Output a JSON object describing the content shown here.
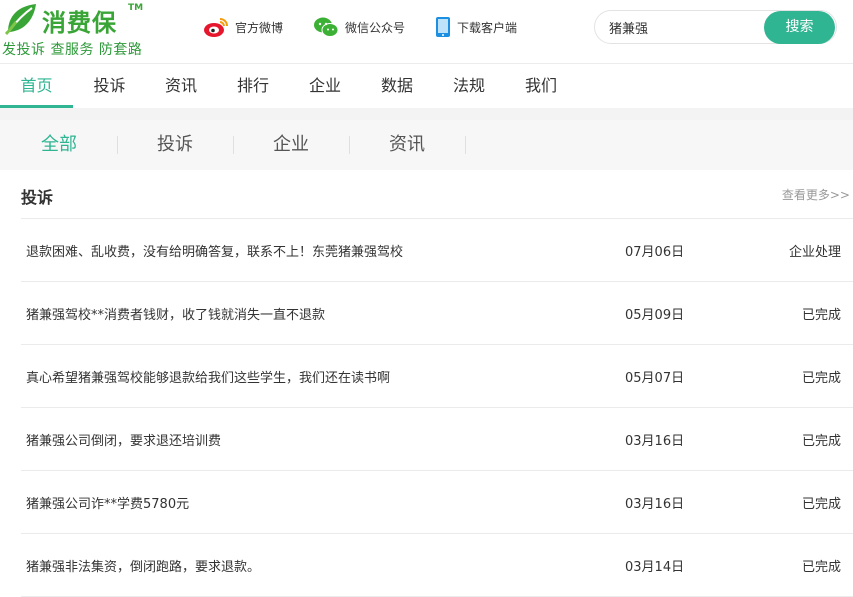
{
  "logo": {
    "name": "消费保",
    "tm": "TM",
    "slogan": "发投诉 查服务 防套路"
  },
  "top_links": [
    {
      "label": "官方微博",
      "icon": "weibo-icon"
    },
    {
      "label": "微信公众号",
      "icon": "wechat-icon"
    },
    {
      "label": "下载客户端",
      "icon": "phone-icon"
    }
  ],
  "search": {
    "value": "猪兼强",
    "button_label": "搜索"
  },
  "nav": {
    "items": [
      "首页",
      "投诉",
      "资讯",
      "排行",
      "企业",
      "数据",
      "法规",
      "我们"
    ],
    "active": "首页"
  },
  "subtabs": {
    "items": [
      "全部",
      "投诉",
      "企业",
      "资讯"
    ],
    "active": "全部"
  },
  "section": {
    "title": "投诉",
    "more_label": "查看更多>>"
  },
  "complaints": [
    {
      "title": "退款困难、乱收费，没有给明确答复，联系不上！东莞猪兼强驾校",
      "date": "07月06日",
      "status": "企业处理"
    },
    {
      "title": "猪兼强驾校**消费者钱财，收了钱就消失一直不退款",
      "date": "05月09日",
      "status": "已完成"
    },
    {
      "title": "真心希望猪兼强驾校能够退款给我们这些学生，我们还在读书啊",
      "date": "05月07日",
      "status": "已完成"
    },
    {
      "title": "猪兼强公司倒闭，要求退还培训费",
      "date": "03月16日",
      "status": "已完成"
    },
    {
      "title": "猪兼强公司诈**学费5780元",
      "date": "03月16日",
      "status": "已完成"
    },
    {
      "title": "猪兼强非法集资，倒闭跑路，要求退款。",
      "date": "03月14日",
      "status": "已完成"
    }
  ],
  "colors": {
    "accent": "#2fb592",
    "logo_green": "#3aa537",
    "weibo_red": "#e6162d",
    "wechat_green": "#3cb034",
    "phone_blue": "#1d8fe1"
  }
}
